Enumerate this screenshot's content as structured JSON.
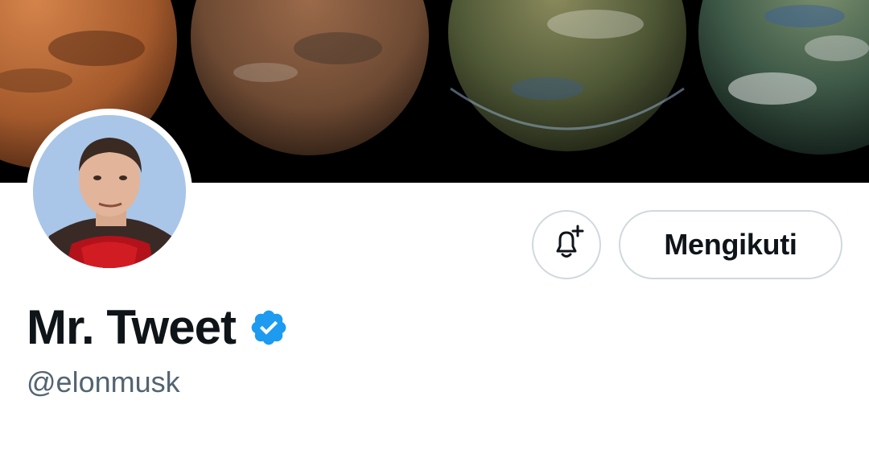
{
  "profile": {
    "display_name": "Mr. Tweet",
    "handle": "@elonmusk",
    "verified": true
  },
  "actions": {
    "follow_label": "Mengikuti",
    "notify_icon": "bell-plus-icon"
  },
  "icons": {
    "verified_badge": "verified-badge-icon"
  },
  "colors": {
    "text_primary": "#0f1419",
    "text_secondary": "#536471",
    "verified_blue": "#1d9bf0",
    "button_border": "#cfd9de",
    "banner_background": "#000000"
  }
}
